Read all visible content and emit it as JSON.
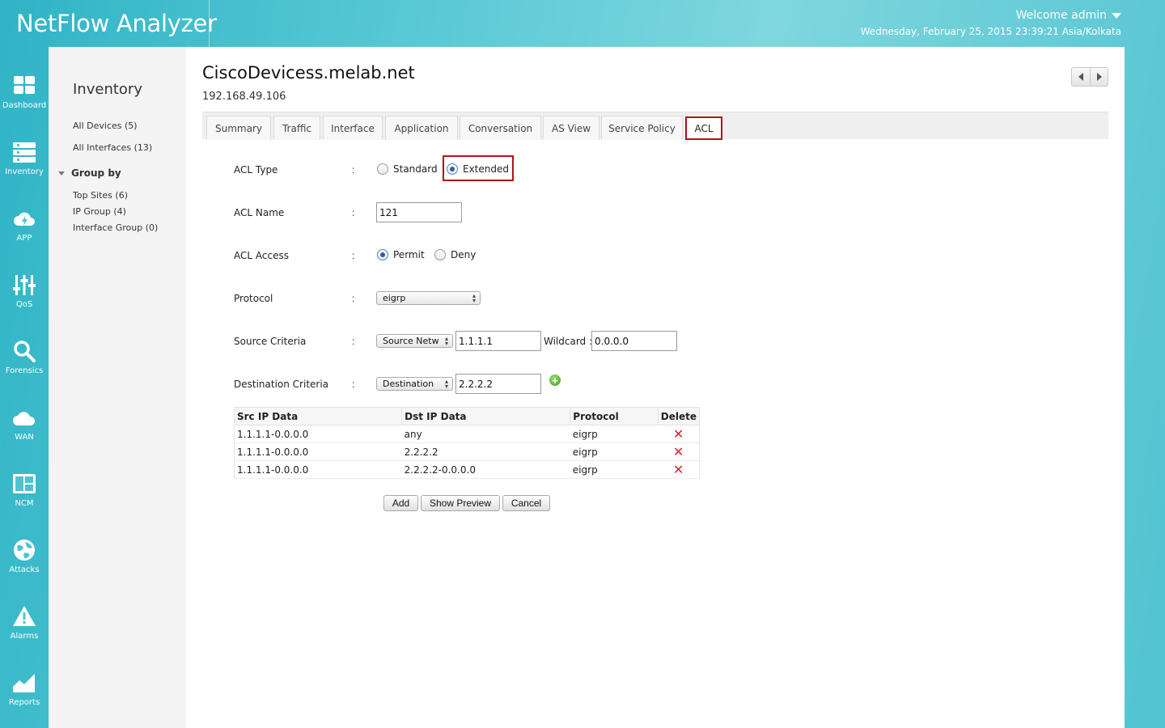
{
  "header": {
    "app_title": "NetFlow Analyzer",
    "welcome": "Welcome admin",
    "datetime": "Wednesday, February 25, 2015 23:39:21 Asia/Kolkata"
  },
  "rail": [
    {
      "label": "Dashboard",
      "icon": "dashboard-icon"
    },
    {
      "label": "Inventory",
      "icon": "inventory-icon"
    },
    {
      "label": "APP",
      "icon": "app-cloud-icon"
    },
    {
      "label": "QoS",
      "icon": "qos-sliders-icon"
    },
    {
      "label": "Forensics",
      "icon": "search-icon"
    },
    {
      "label": "WAN",
      "icon": "wan-cloud-icon"
    },
    {
      "label": "NCM",
      "icon": "ncm-icon"
    },
    {
      "label": "Attacks",
      "icon": "attacks-globe-icon"
    },
    {
      "label": "Alarms",
      "icon": "alarm-warning-icon"
    },
    {
      "label": "Reports",
      "icon": "reports-chart-icon"
    }
  ],
  "sidebar": {
    "title": "Inventory",
    "links": [
      "All Devices (5)",
      "All Interfaces (13)"
    ],
    "group_by": "Group by",
    "groups": [
      "Top Sites (6)",
      "IP Group (4)",
      "Interface Group (0)"
    ]
  },
  "device": {
    "name": "CiscoDevicess.melab.net",
    "ip": "192.168.49.106"
  },
  "tabs": [
    "Summary",
    "Traffic",
    "Interface",
    "Application",
    "Conversation",
    "AS View",
    "Service Policy",
    "ACL"
  ],
  "active_tab": "ACL",
  "form": {
    "acl_type": {
      "label": "ACL Type",
      "options": [
        "Standard",
        "Extended"
      ],
      "selected": "Extended"
    },
    "acl_name": {
      "label": "ACL Name",
      "value": "121"
    },
    "acl_access": {
      "label": "ACL Access",
      "options": [
        "Permit",
        "Deny"
      ],
      "selected": "Permit"
    },
    "protocol": {
      "label": "Protocol",
      "value": "eigrp"
    },
    "source": {
      "label": "Source Criteria",
      "select": "Source Netw",
      "ip": "1.1.1.1",
      "wildcard_label": "Wildcard :",
      "wildcard": "0.0.0.0"
    },
    "destination": {
      "label": "Destination Criteria",
      "select": "Destination",
      "ip": "2.2.2.2"
    },
    "colon": ":"
  },
  "table": {
    "headers": [
      "Src IP Data",
      "Dst IP Data",
      "Protocol",
      "Delete"
    ],
    "rows": [
      [
        "1.1.1.1-0.0.0.0",
        "any",
        "eigrp"
      ],
      [
        "1.1.1.1-0.0.0.0",
        "2.2.2.2",
        "eigrp"
      ],
      [
        "1.1.1.1-0.0.0.0",
        "2.2.2.2-0.0.0.0",
        "eigrp"
      ]
    ]
  },
  "buttons": {
    "add": "Add",
    "preview": "Show Preview",
    "cancel": "Cancel"
  },
  "colors": {
    "highlight": "#b0121a",
    "delete": "#d9262d",
    "header_bg": "#4fc3d2"
  }
}
